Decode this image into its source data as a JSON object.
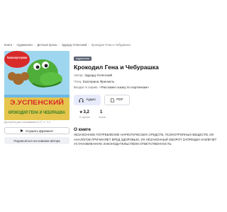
{
  "breadcrumbs": [
    "Книги",
    "Аудиокниги",
    "Детская проза",
    "Эдуард Успенский"
  ],
  "breadcrumb_current": "Крокодил Гена и Чебурашка",
  "cover": {
    "banner_text": "Расскажи сказку по картинкам",
    "author_text": "Э.УСПЕНСКИЙ",
    "title_text": "КРОКОДИЛ ГЕНА И ЧЕБУРАШКА"
  },
  "download_note": "Доступна для скачивания в 17 ч · 1 ч",
  "buttons": {
    "fragment": "Слушать фрагмент",
    "subscribe": "Подписаться на новинки автора"
  },
  "book": {
    "badge": "Аудиокнига",
    "title": "Крокодил Гена и Чебурашка",
    "author_label": "Автор:",
    "author": "Эдуард Успенский",
    "reader_label": "Чтец:",
    "reader": "Екатерина Френкель",
    "series_label": "Входит в серию:",
    "series": "«Расскажи сказку по картинкам»"
  },
  "formats": {
    "audio": "Аудио",
    "pdf": "PDF"
  },
  "stats": {
    "rating": "3,2",
    "rating_caption": "6 оценок",
    "reviews": "1",
    "reviews_caption": "отзыв"
  },
  "about": {
    "heading": "О книге",
    "text": "НЕЗАКОННОЕ ПОТРЕБЛЕНИЕ НАРКОТИЧЕСКИХ СРЕДСТВ, ПСИХОТРОПНЫХ ВЕЩЕСТВ, ИХ АНАЛОГОВ ПРИЧИНЯЕТ ВРЕД ЗДОРОВЬЮ, ИХ НЕЗАКОННЫЙ ОБОРОТ ЗАПРЕЩЕН И ВЛЕЧЕТ УСТАНОВЛЕННУЮ ЗАКОНОДАТЕЛЬСТВОМ ОТВЕТСТВЕННОСТЬ"
  },
  "icons": {
    "play": "play-icon",
    "headphones": "headphones-icon",
    "pdf": "document-icon",
    "star": "star-icon"
  },
  "colors": {
    "badge_bg": "#5d6575",
    "audio_tab_bg": "#e7ebfb",
    "subscribe_bg": "#eef0f6",
    "cover_sky": "#9fd6ef",
    "cover_crocodile": "#4fae3a",
    "cover_banner": "#d92a2a"
  }
}
